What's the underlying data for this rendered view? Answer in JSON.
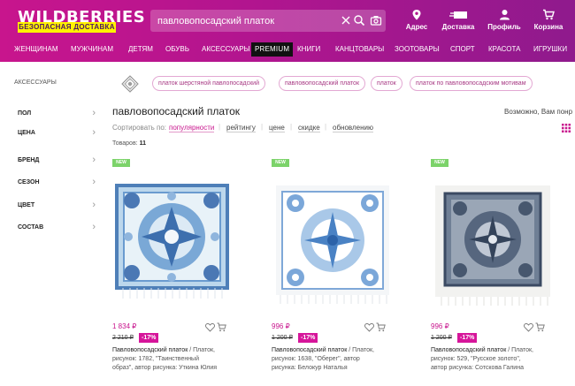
{
  "header": {
    "logo_text": "WILDBERRIES",
    "logo_sub": "БЕЗОПАСНАЯ ДОСТАВКА",
    "search_value": "павловопосадский платок",
    "actions": [
      {
        "label": "Адрес",
        "icon": "location-pin-icon"
      },
      {
        "label": "Доставка",
        "icon": "delivery-icon"
      },
      {
        "label": "Профиль",
        "icon": "profile-icon"
      },
      {
        "label": "Корзина",
        "icon": "cart-icon"
      }
    ]
  },
  "nav": {
    "items": [
      "Женщинам",
      "Мужчинам",
      "Детям",
      "Обувь",
      "Аксессуары",
      "PREMIUM",
      "Книги",
      "Канцтовары",
      "Зоотовары",
      "Спорт",
      "Красота",
      "Игрушки"
    ]
  },
  "breadcrumb": "Аксессуары",
  "tags": [
    "платок шерстяной павлопосадский",
    "павловопосадский платок",
    "платок",
    "платок по павловопосадским мотивам"
  ],
  "filters": [
    "ПОЛ",
    "ЦЕНА",
    "БРЕНД",
    "СЕЗОН",
    "ЦВЕТ",
    "СОСТАВ"
  ],
  "page": {
    "title": "павловопосадский платок",
    "relevance_text": "Возможно, Вам понр",
    "sort_label": "Сортировать по:",
    "sort_options": [
      "популярности",
      "рейтингу",
      "цене",
      "скидке",
      "обновлению"
    ],
    "count_label": "Товаров:",
    "count_value": "11"
  },
  "products": [
    {
      "badge": "NEW",
      "price": "1 834 ₽",
      "old_price": "2 210 ₽",
      "discount": "-17%",
      "brand": "Павловопосадский платок",
      "line1_rest": " / Платок,",
      "line2": "рисунок: 1782, \"Таинственный",
      "line3": "образ\", автор рисунка: Уткина Юлия"
    },
    {
      "badge": "NEW",
      "price": "996 ₽",
      "old_price": "1 200 ₽",
      "discount": "-17%",
      "brand": "Павловопосадский платок",
      "line1_rest": " / Платок,",
      "line2": "рисунок: 1638, \"Оберег\", автор",
      "line3": "рисунка: Белокур Наталья"
    },
    {
      "badge": "NEW",
      "price": "996 ₽",
      "old_price": "1 200 ₽",
      "discount": "-17%",
      "brand": "Павловопосадский платок",
      "line1_rest": " / Платок,",
      "line2": "рисунок: 529, \"Русское золото\",",
      "line3": "автор рисунка: Сотскова Галина"
    }
  ],
  "colors": {
    "brand": "#c8158d",
    "accent_yellow": "#fff200",
    "new_badge": "#7cd36a",
    "discount": "#d6159a"
  }
}
